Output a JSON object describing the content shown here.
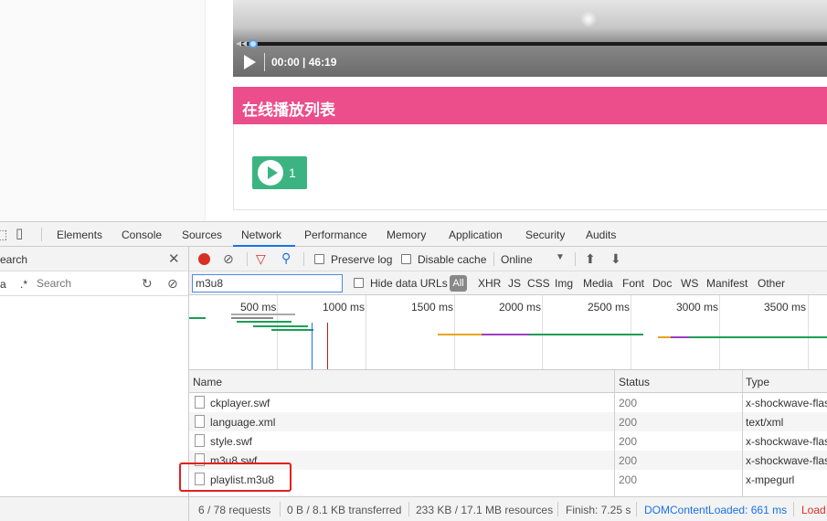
{
  "player": {
    "time": "00:00 | 46:19"
  },
  "playlist": {
    "title": "在线播放列表",
    "episode": "1"
  },
  "devtools": {
    "tabs": [
      "Elements",
      "Console",
      "Sources",
      "Network",
      "Performance",
      "Memory",
      "Application",
      "Security",
      "Audits"
    ],
    "active_tab": "Network",
    "search_panel": {
      "title": "earch",
      "regex": ".*",
      "placeholder": "Search",
      "case_label": "a"
    },
    "toolbar": {
      "preserve_log": "Preserve log",
      "disable_cache": "Disable cache",
      "throttle": "Online"
    },
    "filter": {
      "value": "m3u8",
      "hide_data_urls": "Hide data URLs",
      "all": "All",
      "types": [
        "XHR",
        "JS",
        "CSS",
        "Img",
        "Media",
        "Font",
        "Doc",
        "WS",
        "Manifest",
        "Other"
      ]
    },
    "overview_ticks": [
      "500 ms",
      "1000 ms",
      "1500 ms",
      "2000 ms",
      "2500 ms",
      "3000 ms",
      "3500 ms"
    ],
    "columns": {
      "name": "Name",
      "status": "Status",
      "type": "Type"
    },
    "rows": [
      {
        "name": "ckplayer.swf",
        "status": "200",
        "type": "x-shockwave-flas"
      },
      {
        "name": "language.xml",
        "status": "200",
        "type": "text/xml"
      },
      {
        "name": "style.swf",
        "status": "200",
        "type": "x-shockwave-flas"
      },
      {
        "name": "m3u8.swf",
        "status": "200",
        "type": "x-shockwave-flas"
      },
      {
        "name": "playlist.m3u8",
        "status": "200",
        "type": "x-mpegurl"
      }
    ],
    "status": {
      "requests": "6 / 78 requests",
      "transferred": "0 B / 8.1 KB transferred",
      "resources": "233 KB / 17.1 MB resources",
      "finish": "Finish: 7.25 s",
      "dcl": "DOMContentLoaded: 661 ms",
      "load": "Load:"
    },
    "colors": {
      "dcl": "#1a73e8",
      "load": "#d93025",
      "record": "#d93025",
      "highlight": "#e02020"
    }
  }
}
